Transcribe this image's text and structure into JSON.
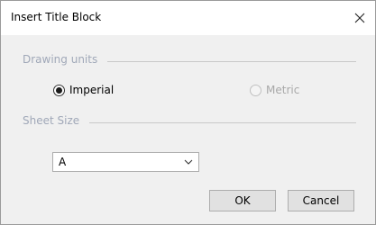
{
  "dialog": {
    "title": "Insert Title Block",
    "close_icon": "close-icon"
  },
  "drawing_units": {
    "label": "Drawing units",
    "options": [
      {
        "label": "Imperial",
        "selected": true,
        "enabled": true
      },
      {
        "label": "Metric",
        "selected": false,
        "enabled": false
      }
    ]
  },
  "sheet_size": {
    "label": "Sheet Size",
    "value": "A",
    "dropdown_icon": "chevron-down-icon"
  },
  "buttons": {
    "ok": "OK",
    "cancel": "Cancel"
  }
}
